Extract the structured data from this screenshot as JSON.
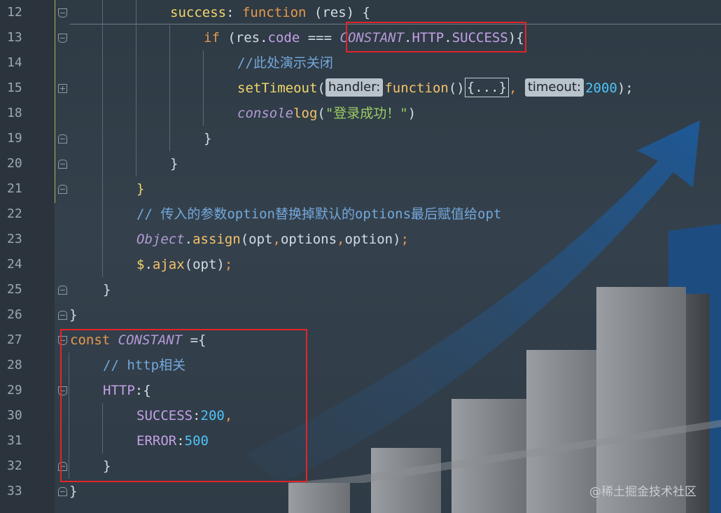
{
  "line_numbers": [
    "12",
    "13",
    "14",
    "15",
    "18",
    "19",
    "20",
    "21",
    "22",
    "23",
    "24",
    "25",
    "26",
    "27",
    "28",
    "29",
    "30",
    "31",
    "32",
    "33"
  ],
  "code": {
    "l12": {
      "a": "success",
      "b": ": ",
      "c": "function",
      "d": " (res) {"
    },
    "l13": {
      "a": "if",
      "b": " (res.",
      "c": "code",
      "d": " === ",
      "e": "CONSTANT",
      "f": ".",
      "g": "HTTP",
      "h": ".",
      "i": "SUCCESS",
      "j": "){"
    },
    "l14": {
      "a": "//此处演示关闭"
    },
    "l15": {
      "a": "setTimeout",
      "b": "(",
      "hint1": "handler:",
      "c": "function",
      "d": "()",
      "e": "{...}",
      ",": ", ",
      "hint2": "timeout:",
      "f": "2000",
      "g": ");"
    },
    "l18": {
      "a": "console",
      ".": ".",
      "b": "log",
      "c": "(",
      "d": "\"登录成功！\"",
      "e": ")"
    },
    "l19": {
      "a": "}"
    },
    "l20": {
      "a": "}"
    },
    "l21": {
      "a": "}"
    },
    "l22": {
      "a": "// 传入的参数option替换掉默认的options最后赋值给opt"
    },
    "l23": {
      "a": "Object",
      "b": ".",
      "c": "assign",
      "d": "(opt",
      "e": ",",
      "f": "options",
      "g": ",",
      "h": "option)",
      "i": ";"
    },
    "l24": {
      "a": "$",
      "b": ".",
      "c": "ajax",
      "d": "(opt)",
      "e": ";"
    },
    "l25": {
      "a": "}"
    },
    "l26": {
      "a": "}"
    },
    "l27": {
      "a": "const",
      "b": " ",
      "c": "CONSTANT",
      "d": " ={"
    },
    "l28": {
      "a": "// http相关"
    },
    "l29": {
      "a": "HTTP",
      "b": ":{"
    },
    "l30": {
      "a": "SUCCESS",
      "b": ":",
      "c": "200",
      "d": ","
    },
    "l31": {
      "a": "ERROR",
      "b": ":",
      "c": "500"
    },
    "l32": {
      "a": "}"
    },
    "l33": {
      "a": "}"
    }
  },
  "watermark": "@稀土掘金技术社区",
  "colors": {
    "keyword": "#e89a4b",
    "property": "#c4a1e6",
    "function": "#f2d66b",
    "number": "#4fc3f7",
    "string": "#9ccc65",
    "comment": "#74a8dc",
    "highlight_box": "#e0252a"
  }
}
